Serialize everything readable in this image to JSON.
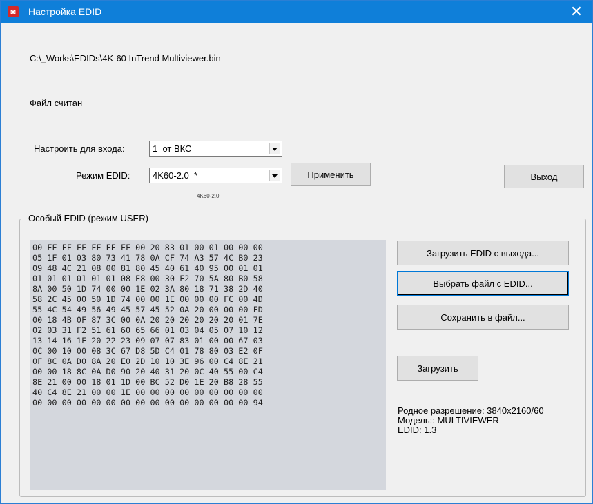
{
  "window": {
    "title": "Настройка EDID",
    "icon": "app-logo-icon",
    "close": "✕"
  },
  "file_path": "C:\\_Works\\EDIDs\\4K-60 InTrend Multiviewer.bin",
  "status": "Файл считан",
  "input_setting": {
    "label": "Настроить для входа:",
    "value": "1  от ВКС"
  },
  "edid_mode": {
    "label": "Режим EDID:",
    "value": "4K60-2.0  *",
    "note": "4K60-2.0"
  },
  "buttons": {
    "apply": "Применить",
    "exit": "Выход",
    "load_from_output": "Загрузить EDID с выхода...",
    "choose_file": "Выбрать файл с EDID...",
    "save_to_file": "Сохранить в файл...",
    "load": "Загрузить"
  },
  "user_edid_group": {
    "label": "Особый EDID (режим USER)",
    "hex_lines": [
      "00 FF FF FF FF FF FF 00 20 83 01 00 01 00 00 00",
      "05 1F 01 03 80 73 41 78 0A CF 74 A3 57 4C B0 23",
      "09 48 4C 21 08 00 81 80 45 40 61 40 95 00 01 01",
      "01 01 01 01 01 01 08 E8 00 30 F2 70 5A 80 B0 58",
      "8A 00 50 1D 74 00 00 1E 02 3A 80 18 71 38 2D 40",
      "58 2C 45 00 50 1D 74 00 00 1E 00 00 00 FC 00 4D",
      "55 4C 54 49 56 49 45 57 45 52 0A 20 00 00 00 FD",
      "00 18 4B 0F 87 3C 00 0A 20 20 20 20 20 20 01 7E",
      "02 03 31 F2 51 61 60 65 66 01 03 04 05 07 10 12",
      "13 14 16 1F 20 22 23 09 07 07 83 01 00 00 67 03",
      "0C 00 10 00 08 3C 67 D8 5D C4 01 78 80 03 E2 0F",
      "0F 8C 0A D0 8A 20 E0 2D 10 10 3E 96 00 C4 8E 21",
      "00 00 18 8C 0A D0 90 20 40 31 20 0C 40 55 00 C4",
      "8E 21 00 00 18 01 1D 00 BC 52 D0 1E 20 B8 28 55",
      "40 C4 8E 21 00 00 1E 00 00 00 00 00 00 00 00 00",
      "00 00 00 00 00 00 00 00 00 00 00 00 00 00 00 94"
    ],
    "info": {
      "native_resolution": "Родное разрешение: 3840x2160/60",
      "model": "Модель:: MULTIVIEWER",
      "edid_version": "EDID: 1.3"
    }
  }
}
